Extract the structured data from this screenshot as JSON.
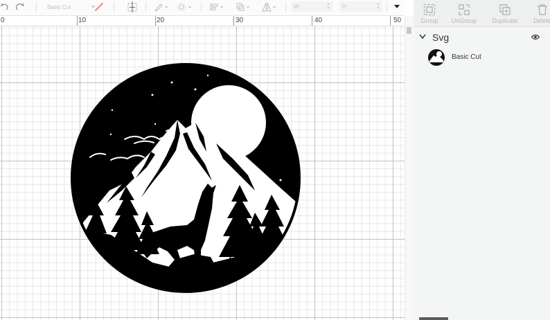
{
  "toolbar": {
    "undo_icon": "undo-icon",
    "redo_icon": "redo-icon",
    "operation": "Basic Cut",
    "width_label": "W",
    "height_label": "H"
  },
  "ruler": {
    "marks": [
      "0",
      "10",
      "20",
      "30",
      "40",
      "50"
    ]
  },
  "panel": {
    "tools": [
      {
        "label": "Group",
        "icon": "group-icon"
      },
      {
        "label": "UnGroup",
        "icon": "ungroup-icon"
      },
      {
        "label": "Duplicate",
        "icon": "duplicate-icon"
      },
      {
        "label": "Delete",
        "icon": "delete-icon"
      }
    ],
    "group_name": "Svg",
    "layer_name": "Basic Cut"
  },
  "colors": {
    "design_fill": "#000000",
    "panel_bg": "#f4f5f5",
    "disabled_text": "#b8b8b8"
  }
}
